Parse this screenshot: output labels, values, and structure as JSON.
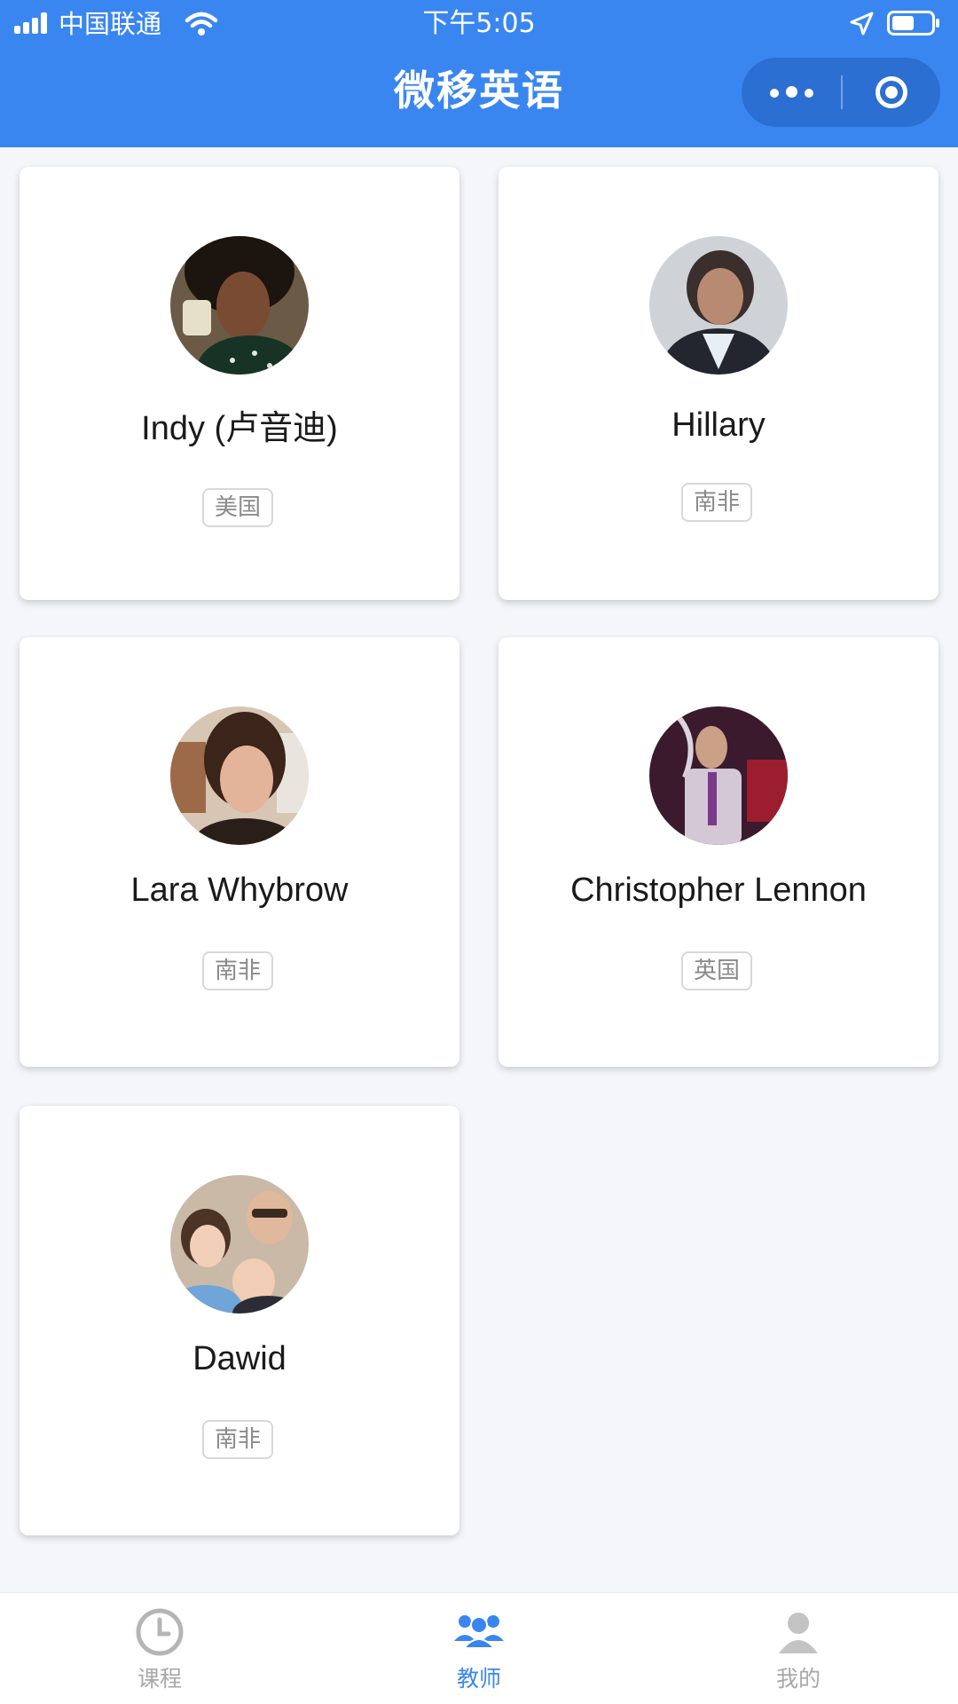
{
  "status_bar": {
    "carrier": "中国联通",
    "time": "下午5:05"
  },
  "nav": {
    "title": "微移英语"
  },
  "teachers": [
    {
      "name": "Indy (卢音迪)",
      "country": "美国"
    },
    {
      "name": "Hillary",
      "country": "南非"
    },
    {
      "name": "Lara Whybrow",
      "country": "南非"
    },
    {
      "name": "Christopher Lennon",
      "country": "英国"
    },
    {
      "name": "Dawid",
      "country": "南非"
    }
  ],
  "tabbar": {
    "items": [
      {
        "label": "课程",
        "icon": "clock-icon",
        "active": false
      },
      {
        "label": "教师",
        "icon": "people-icon",
        "active": true
      },
      {
        "label": "我的",
        "icon": "person-icon",
        "active": false
      }
    ]
  },
  "colors": {
    "brand": "#3a86f0",
    "capsule": "#2b6fd2",
    "background": "#f4f6fa",
    "tab_inactive": "#a8a8a8"
  }
}
